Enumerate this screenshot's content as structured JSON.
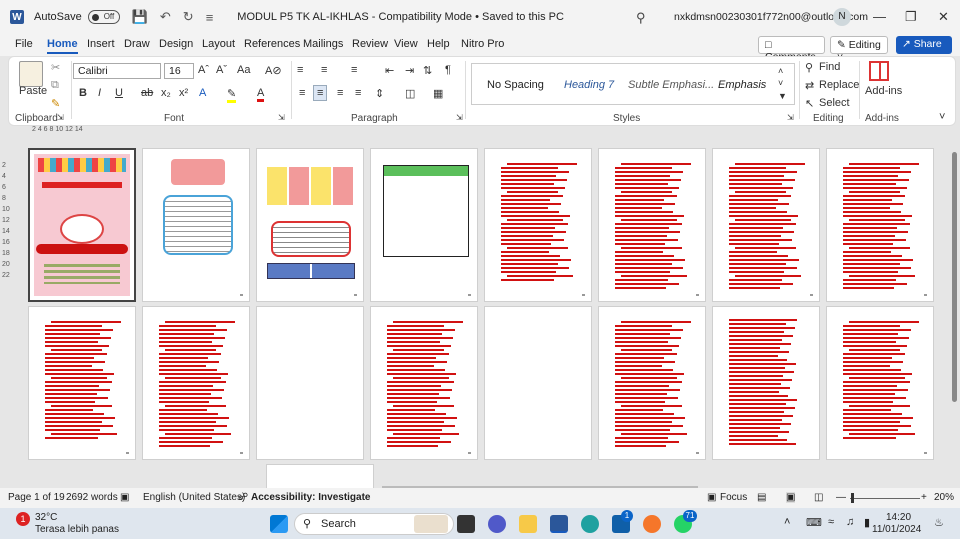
{
  "titlebar": {
    "autosave_label": "AutoSave",
    "autosave_state": "Off",
    "document_title": "MODUL P5 TK AL-IKHLAS  -  Compatibility Mode  •  Saved to this PC",
    "account_email": "nxkdmsn00230301f772n00@outlook.com",
    "avatar_initial": "N"
  },
  "menu": {
    "items": [
      "File",
      "Home",
      "Insert",
      "Draw",
      "Design",
      "Layout",
      "References",
      "Mailings",
      "Review",
      "View",
      "Help",
      "Nitro Pro"
    ],
    "active": "Home",
    "comments_label": "Comments",
    "editing_label": "Editing",
    "share_label": "Share"
  },
  "ribbon": {
    "clipboard": {
      "label": "Clipboard",
      "paste_label": "Paste"
    },
    "font": {
      "label": "Font",
      "font_name": "Calibri",
      "font_size": "16"
    },
    "paragraph": {
      "label": "Paragraph"
    },
    "styles": {
      "label": "Styles",
      "items": [
        "No Spacing",
        "Heading 7",
        "Subtle Emphasi...",
        "Emphasis"
      ]
    },
    "editing": {
      "label": "Editing",
      "find": "Find",
      "replace": "Replace",
      "select": "Select"
    },
    "addins": {
      "label": "Add-ins",
      "button": "Add-ins"
    }
  },
  "ruler": {
    "marks": "2  4  6  8  10 12 14"
  },
  "vruler": {
    "marks": [
      "2",
      "4",
      "6",
      "8",
      "10",
      "12",
      "14",
      "16",
      "18",
      "20",
      "22"
    ]
  },
  "statusbar": {
    "page": "Page 1 of 19",
    "words": "2692 words",
    "language": "English (United States)",
    "accessibility": "Accessibility: Investigate",
    "focus": "Focus",
    "zoom": "20%"
  },
  "taskbar": {
    "weather_temp": "32°C",
    "weather_desc": "Terasa lebih panas",
    "weather_badge": "1",
    "search_placeholder": "Search",
    "time": "14:20",
    "date": "11/01/2024",
    "teams_badge": "1",
    "whatsapp_badge": "71"
  },
  "colors": {
    "accent": "#185abd",
    "text_red": "#d11111",
    "cover_pink": "#f7c9d2",
    "word_blue": "#2b579a"
  }
}
